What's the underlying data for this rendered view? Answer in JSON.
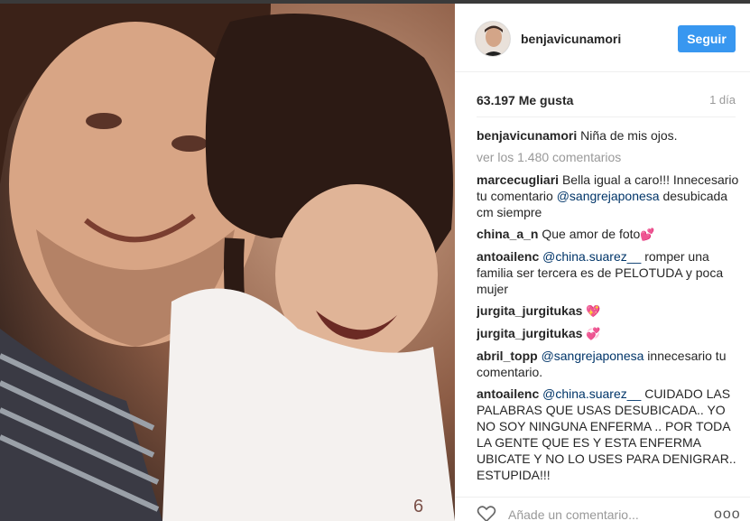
{
  "post": {
    "username": "benjavicunamori",
    "follow_label": "Seguir",
    "likes": "63.197 Me gusta",
    "time": "1 día",
    "caption": {
      "user": "benjavicunamori",
      "text": "Niña de mis ojos."
    },
    "view_all": "ver los 1.480 comentarios"
  },
  "comments": [
    {
      "user": "marcecugliari",
      "parts": [
        {
          "t": "Bella igual a caro!!! Innecesario tu comentario "
        },
        {
          "t": "@sangrejaponesa",
          "m": true
        },
        {
          "t": " desubicada cm siempre"
        }
      ]
    },
    {
      "user": "china_a_n",
      "parts": [
        {
          "t": "Que amor de foto"
        }
      ],
      "emoji": "💕"
    },
    {
      "user": "antoailenc",
      "parts": [
        {
          "t": "@china.suarez__",
          "m": true
        },
        {
          "t": " romper una familia ser tercera es de PELOTUDA y poca mujer"
        }
      ]
    },
    {
      "user": "jurgita_jurgitukas",
      "parts": [
        {
          "t": ""
        }
      ],
      "emoji": "💖"
    },
    {
      "user": "jurgita_jurgitukas",
      "parts": [
        {
          "t": ""
        }
      ],
      "emoji": "💞"
    },
    {
      "user": "abril_topp",
      "parts": [
        {
          "t": "@sangrejaponesa",
          "m": true
        },
        {
          "t": " innecesario tu comentario."
        }
      ]
    },
    {
      "user": "antoailenc",
      "parts": [
        {
          "t": "@china.suarez__",
          "m": true
        },
        {
          "t": " CUIDADO LAS PALABRAS QUE USAS DESUBICADA.. YO NO SOY NINGUNA ENFERMA .. POR TODA LA GENTE QUE ES Y ESTA ENFERMA UBICATE Y NO LO USES PARA DENIGRAR.. ESTUPIDA!!!"
        }
      ]
    }
  ],
  "add_comment": {
    "placeholder": "Añade un comentario...",
    "more_label": "ooo"
  },
  "icons": {
    "like": "heart-outline-icon",
    "more": "more-options-icon"
  },
  "colors": {
    "accent": "#3897f0",
    "mention": "#003569",
    "muted": "#999999"
  }
}
